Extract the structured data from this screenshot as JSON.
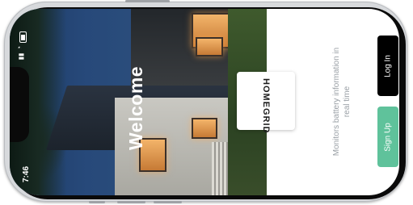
{
  "status_bar": {
    "time": "7:46"
  },
  "hero": {
    "title": "Welcome"
  },
  "brand": {
    "logo_text": "HOMEGRID"
  },
  "tagline": "Monitors battery information in real time",
  "actions": {
    "login_label": "Log In",
    "signup_label": "Sign Up"
  },
  "colors": {
    "login_bg": "#000000",
    "signup_bg": "#5fc29b",
    "tagline": "#9aa0a6"
  },
  "icons": [
    "battery-icon",
    "wifi-icon",
    "signal-icon"
  ]
}
